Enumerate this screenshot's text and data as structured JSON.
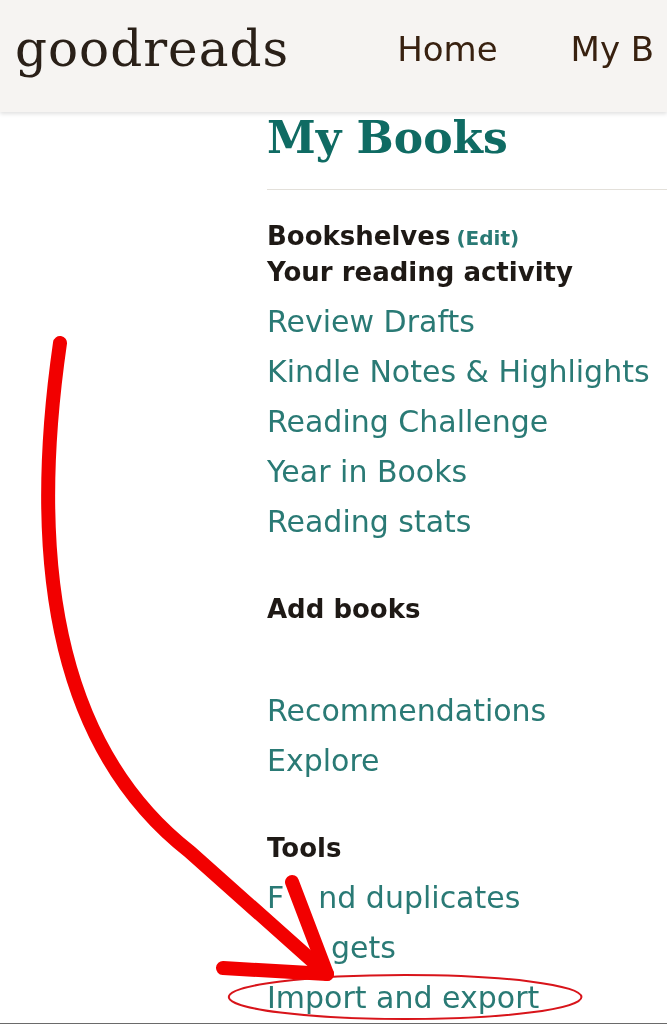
{
  "header": {
    "logo": "goodreads",
    "nav": [
      {
        "label": "Home"
      },
      {
        "label": "My B"
      }
    ]
  },
  "page_title": "My Books",
  "sidebar": {
    "sections": [
      {
        "title": "Bookshelves",
        "action": "(Edit)"
      },
      {
        "title": "Your reading activity",
        "links": [
          {
            "label": "Review Drafts",
            "highlighted": false
          },
          {
            "label": "Kindle Notes & Highlights",
            "highlighted": false
          },
          {
            "label": "Reading Challenge",
            "highlighted": false
          },
          {
            "label": "Year in Books",
            "highlighted": false
          },
          {
            "label": "Reading stats",
            "highlighted": false
          }
        ]
      },
      {
        "title": "Add books",
        "links": [
          {
            "label": "Recommendations",
            "highlighted": false
          },
          {
            "label": "Explore",
            "highlighted": false
          }
        ]
      },
      {
        "title": "Tools",
        "links": [
          {
            "visible_parts": [
              "F",
              "nd duplicates"
            ],
            "highlighted": false
          },
          {
            "visible_parts": [
              "gets"
            ],
            "starts_covered": true,
            "highlighted": false
          },
          {
            "label": "Import and export",
            "highlighted": true
          }
        ]
      }
    ]
  }
}
